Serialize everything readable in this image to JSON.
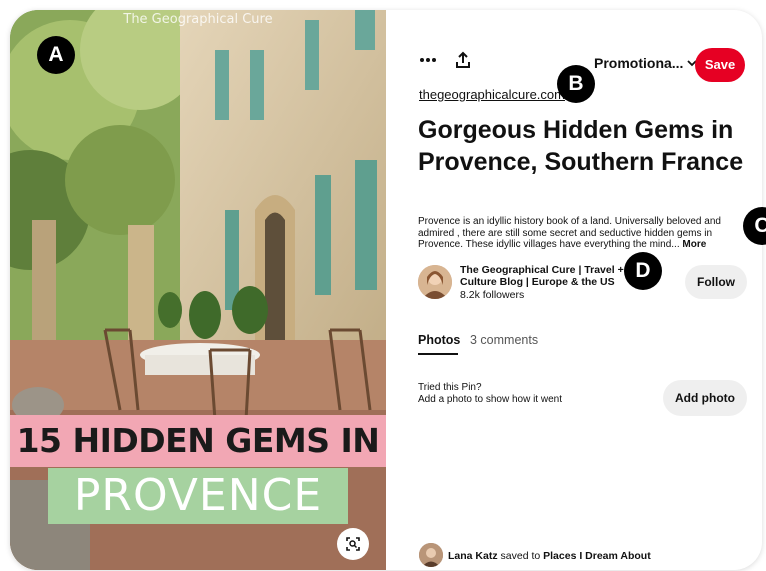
{
  "image": {
    "watermark": "The Geographical Cure",
    "banner_line1": "15 HIDDEN GEMS IN",
    "banner_line2": "PROVENCE"
  },
  "toolbar": {
    "more_icon": "ellipsis-icon",
    "share_icon": "share-upload-icon",
    "board_select": "Promotiona...",
    "save_label": "Save"
  },
  "pin": {
    "source": "thegeographicalcure.com",
    "title": "Gorgeous Hidden Gems in Provence, Southern France",
    "description": "Provence is an idyllic history book of a land. Universally beloved and admired , there are still some secret and seductive hidden gems in Provence. These idyllic villages have everything the mind...",
    "more_label": "More"
  },
  "creator": {
    "name": "The Geographical Cure | Travel + Culture Blog | Europe & the US",
    "followers": "8.2k followers",
    "follow_label": "Follow"
  },
  "tabs": {
    "photos": "Photos",
    "comments": "3 comments"
  },
  "tried": {
    "title": "Tried this Pin?",
    "subtitle": "Add a photo to show how it went",
    "button": "Add photo"
  },
  "saved": {
    "user": "Lana Katz",
    "middle": "saved to",
    "board": "Places I Dream About"
  },
  "markers": {
    "a": "A",
    "b": "B",
    "c": "C",
    "d": "D"
  },
  "colors": {
    "save": "#e60023",
    "banner_pink": "#f2a7b4",
    "banner_green": "#a6d2a0"
  }
}
